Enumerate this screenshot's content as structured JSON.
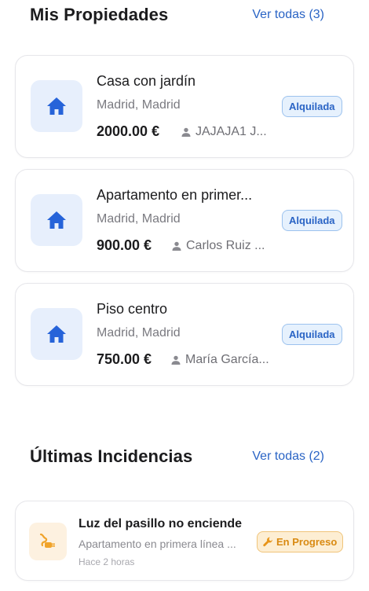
{
  "properties_section": {
    "title": "Mis Propiedades",
    "see_all": "Ver todas (3)"
  },
  "properties": [
    {
      "title": "Casa con jardín",
      "location": "Madrid, Madrid",
      "price": "2000.00 €",
      "tenant": "JAJAJA1 J...",
      "status": "Alquilada",
      "icon": "home-icon"
    },
    {
      "title": "Apartamento en primer...",
      "location": "Madrid, Madrid",
      "price": "900.00 €",
      "tenant": "Carlos Ruiz ...",
      "status": "Alquilada",
      "icon": "home-icon"
    },
    {
      "title": "Piso centro",
      "location": "Madrid, Madrid",
      "price": "750.00 €",
      "tenant": "María García...",
      "status": "Alquilada",
      "icon": "home-icon"
    }
  ],
  "incidents_section": {
    "title": "Últimas Incidencias",
    "see_all": "Ver todas (2)"
  },
  "incidents": [
    {
      "title": "Luz del pasillo no enciende",
      "subtitle": "Apartamento en primera línea ...",
      "time": "Hace 2 horas",
      "status": "En Progreso",
      "icon": "plug-icon",
      "status_icon": "wrench-icon"
    }
  ],
  "colors": {
    "accent": "#2a64c5",
    "rented_badge_bg": "#e6f1fd",
    "progress_badge_bg": "#fdeed3",
    "progress_badge_text": "#d98a12"
  }
}
